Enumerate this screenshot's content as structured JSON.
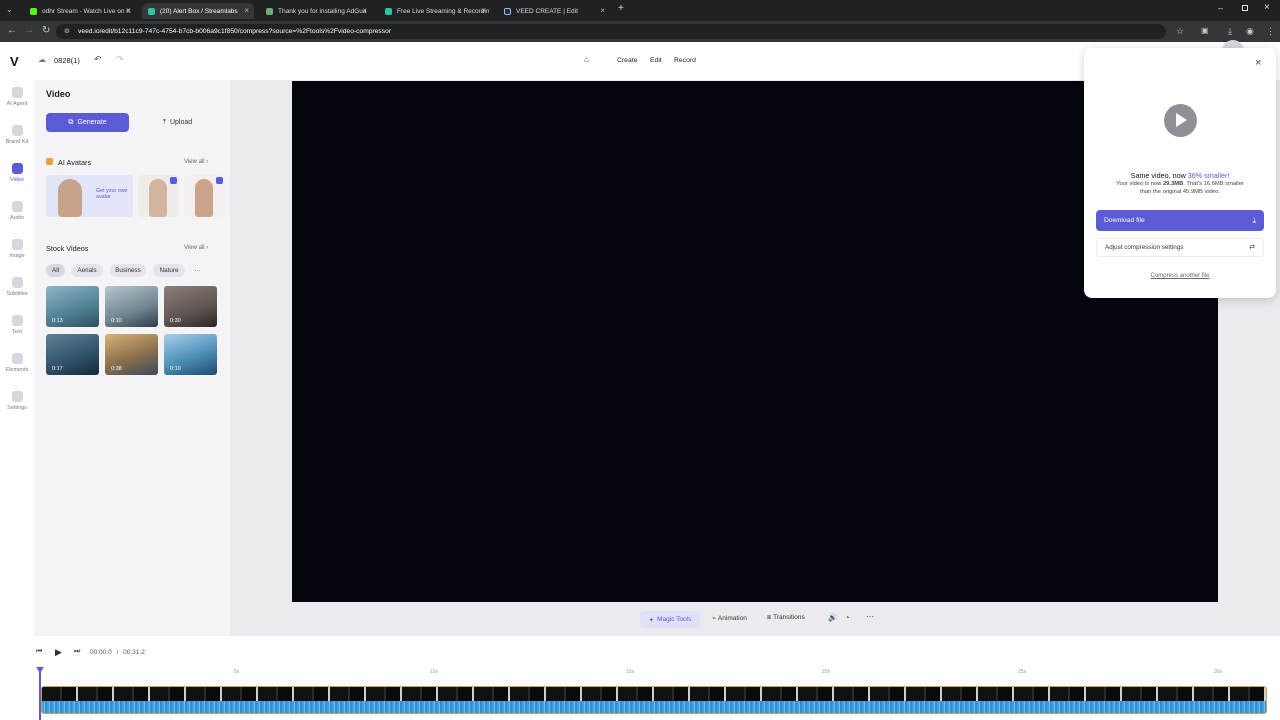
{
  "browser": {
    "tabs": [
      {
        "label": "odhr Stream - Watch Live on K",
        "favicon_color": "#53fc18"
      },
      {
        "label": "(20) Alert Box / Streamlabs",
        "favicon_color": "#31c3a2"
      },
      {
        "label": "Thank you for installing AdGua",
        "favicon_color": "#67b279"
      },
      {
        "label": "Free Live Streaming & Recordin",
        "favicon_color": "#31c3a2"
      },
      {
        "label": "VEED CREATE | Edit",
        "favicon_color": "#1f2d3d"
      }
    ],
    "new_tab_label": "+",
    "url": "veed.io/edit/b12c11c9-747c-4754-b7cb-b006a9c1f850/compress?source=%2Ftools%2Fvideo-compressor"
  },
  "app": {
    "logo": "V",
    "project_name": "0828(1)",
    "nav": [
      "Create",
      "Edit",
      "Record"
    ],
    "accent": "#5b5bd6",
    "rail": [
      {
        "label": "AI Agent",
        "icon": "sparkle-icon"
      },
      {
        "label": "Brand Kit",
        "icon": "brand-kit-icon"
      },
      {
        "label": "Video",
        "icon": "video-icon",
        "active": true
      },
      {
        "label": "Audio",
        "icon": "audio-icon"
      },
      {
        "label": "Image",
        "icon": "image-icon"
      },
      {
        "label": "Subtitles",
        "icon": "subtitles-icon"
      },
      {
        "label": "Text",
        "icon": "text-icon"
      },
      {
        "label": "Elements",
        "icon": "elements-icon"
      },
      {
        "label": "Settings",
        "icon": "settings-icon"
      }
    ],
    "panel": {
      "title": "Video",
      "generate_label": "Generate",
      "upload_label": "Upload",
      "avatars_title": "AI Avatars",
      "view_all": "View all",
      "avatar_promo": "Get your own avatar",
      "stock_title": "Stock Videos",
      "filters": [
        "All",
        "Aerials",
        "Business",
        "Nature",
        "···"
      ],
      "stock_items": [
        {
          "duration": "0:13",
          "color": "#4f7f93"
        },
        {
          "duration": "0:10",
          "color": "#6f8590"
        },
        {
          "duration": "0:30",
          "color": "#5e5552"
        },
        {
          "duration": "0:17",
          "color": "#2f5067"
        },
        {
          "duration": "0:38",
          "color": "#8c6f4c"
        },
        {
          "duration": "0:10",
          "color": "#4e8fb8"
        }
      ]
    },
    "toolbar": {
      "magic_tools": "Magic Tools",
      "animation": "Animation",
      "transitions": "Transitions"
    },
    "player": {
      "current_time": "00:00.0",
      "separator": "/",
      "total_time": "00:31.2"
    },
    "timeline": {
      "ticks": [
        "5s",
        "10s",
        "15s",
        "20s",
        "25s",
        "30s"
      ]
    }
  },
  "popup": {
    "headline_prefix": "Same video, now ",
    "headline_highlight": "36% smaller!",
    "detail_line1_prefix": "Your video is now ",
    "detail_size": "29.3MB",
    "detail_line1_suffix": ". That's 16.6MB smaller",
    "detail_line2": "than the original 45.9MB video.",
    "download_label": "Download file",
    "adjust_label": "Adjust compression settings",
    "compress_another": "Compress another file"
  }
}
